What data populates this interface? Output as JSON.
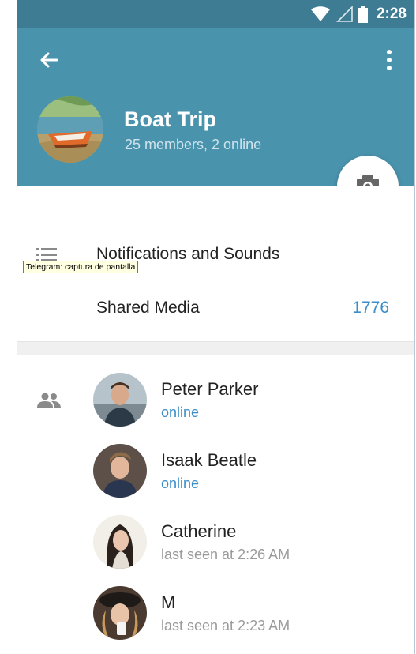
{
  "status_bar": {
    "time": "2:28",
    "icons": [
      "wifi-icon",
      "signal-icon",
      "battery-icon"
    ]
  },
  "header": {
    "back_icon": "arrow-left-icon",
    "menu_icon": "more-vert-icon",
    "group_title": "Boat Trip",
    "group_subtitle": "25 members, 2 online",
    "camera_icon": "camera-icon"
  },
  "settings": [
    {
      "icon": "list-icon",
      "label": "Notifications and Sounds",
      "count": ""
    },
    {
      "icon": "",
      "label": "Shared Media",
      "count": "1776"
    }
  ],
  "tooltip": "Telegram: captura de pantalla",
  "members": [
    {
      "name": "Peter Parker",
      "status": "online",
      "online": true
    },
    {
      "name": "Isaak Beatle",
      "status": "online",
      "online": true
    },
    {
      "name": "Catherine",
      "status": "last seen at 2:26 AM",
      "online": false
    },
    {
      "name": "M",
      "status": "last seen at 2:23 AM",
      "online": false
    }
  ],
  "colors": {
    "header_bg": "#4a93ad",
    "statusbar_bg": "#3e7c93",
    "accent_blue": "#3a8dc8"
  }
}
